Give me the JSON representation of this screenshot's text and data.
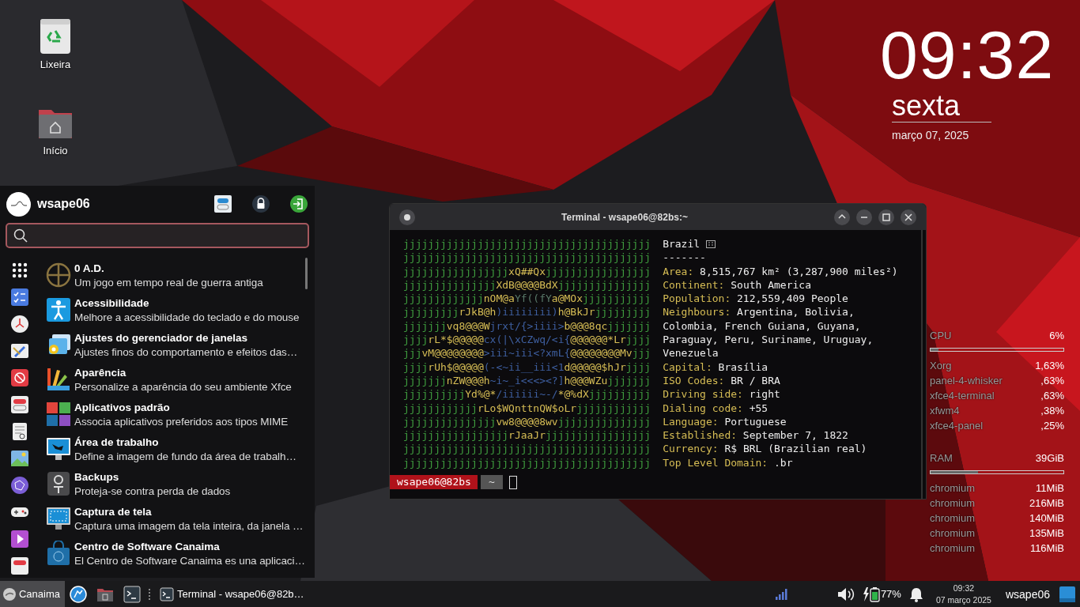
{
  "desktop_icons": [
    {
      "label": "Lixeira"
    },
    {
      "label": "Início"
    }
  ],
  "clock": {
    "time": "09:32",
    "weekday": "sexta",
    "date": "março 07, 2025"
  },
  "menu": {
    "user": "wsape06",
    "apps": [
      {
        "title": "0 A.D.",
        "description": "Um jogo em tempo real de guerra antiga"
      },
      {
        "title": "Acessibilidade",
        "description": "Melhore a acessibilidade do teclado e do mouse"
      },
      {
        "title": "Ajustes do gerenciador de janelas",
        "description": "Ajustes finos do comportamento e efeitos das…"
      },
      {
        "title": "Aparência",
        "description": "Personalize a aparência do seu ambiente Xfce"
      },
      {
        "title": "Aplicativos padrão",
        "description": "Associa aplicativos preferidos aos tipos MIME"
      },
      {
        "title": "Área de trabalho",
        "description": "Define a imagem de fundo da área de trabalh…"
      },
      {
        "title": "Backups",
        "description": "Proteja-se contra perda de dados"
      },
      {
        "title": "Captura de tela",
        "description": "Captura uma imagem da tela inteira, da janela …"
      },
      {
        "title": "Centro de Software Canaima",
        "description": "El Centro de Software Canaima es una aplicaci…"
      }
    ]
  },
  "terminal": {
    "title": "Terminal - wsape06@82bs:~",
    "art": [
      [
        {
          "text": "jjjjjjjjjjjjjjjjjjjjjjjjjjjjjjjjjjjjjjjj",
          "color": "#3f9e3f"
        }
      ],
      [
        {
          "text": "jjjjjjjjjjjjjjjjjjjjjjjjjjjjjjjjjjjjjjjj",
          "color": "#3f9e3f"
        }
      ],
      [
        {
          "text": "jjjjjjjjjjjjjjjjj",
          "color": "#3f9e3f"
        },
        {
          "text": "xQ##Qx",
          "color": "#d6bd55"
        },
        {
          "text": "jjjjjjjjjjjjjjjjj",
          "color": "#3f9e3f"
        }
      ],
      [
        {
          "text": "jjjjjjjjjjjjjjj",
          "color": "#3f9e3f"
        },
        {
          "text": "XdB@@@@BdX",
          "color": "#d6bd55"
        },
        {
          "text": "jjjjjjjjjjjjjjj",
          "color": "#3f9e3f"
        }
      ],
      [
        {
          "text": "jjjjjjjjjjjjj",
          "color": "#3f9e3f"
        },
        {
          "text": "nOM@a",
          "color": "#d6bd55"
        },
        {
          "text": "Yf((fY",
          "color": "#5a7a6a"
        },
        {
          "text": "a@MOx",
          "color": "#d6bd55"
        },
        {
          "text": "jjjjjjjjjjj",
          "color": "#3f9e3f"
        }
      ],
      [
        {
          "text": "jjjjjjjjj",
          "color": "#3f9e3f"
        },
        {
          "text": "rJkB@h",
          "color": "#d6bd55"
        },
        {
          "text": ")iiiiiiii)",
          "color": "#3e5fa0"
        },
        {
          "text": "h@BkJr",
          "color": "#d6bd55"
        },
        {
          "text": "jjjjjjjjj",
          "color": "#3f9e3f"
        }
      ],
      [
        {
          "text": "jjjjjjj",
          "color": "#3f9e3f"
        },
        {
          "text": "vq8@@@W",
          "color": "#d6bd55"
        },
        {
          "text": "jrxt/{>iiii>",
          "color": "#3e5fa0"
        },
        {
          "text": "b@@@8qc",
          "color": "#d6bd55"
        },
        {
          "text": "jjjjjjj",
          "color": "#3f9e3f"
        }
      ],
      [
        {
          "text": "jjjj",
          "color": "#3f9e3f"
        },
        {
          "text": "rL*$@@@@@",
          "color": "#d6bd55"
        },
        {
          "text": "cx(|\\xCZwq/<i{",
          "color": "#3e5fa0"
        },
        {
          "text": "@@@@@@*Lr",
          "color": "#d6bd55"
        },
        {
          "text": "jjjj",
          "color": "#3f9e3f"
        }
      ],
      [
        {
          "text": "jjj",
          "color": "#3f9e3f"
        },
        {
          "text": "vM@@@@@@@@",
          "color": "#d6bd55"
        },
        {
          "text": ">iii~iii<?xmL{",
          "color": "#3e5fa0"
        },
        {
          "text": "@@@@@@@@Mv",
          "color": "#d6bd55"
        },
        {
          "text": "jjj",
          "color": "#3f9e3f"
        }
      ],
      [
        {
          "text": "jjjj",
          "color": "#3f9e3f"
        },
        {
          "text": "rUh$@@@@@",
          "color": "#d6bd55"
        },
        {
          "text": "(-<~ii__iii<1",
          "color": "#3e5fa0"
        },
        {
          "text": "d@@@@@$hJr",
          "color": "#d6bd55"
        },
        {
          "text": "jjjj",
          "color": "#3f9e3f"
        }
      ],
      [
        {
          "text": "jjjjjjj",
          "color": "#3f9e3f"
        },
        {
          "text": "nZW@@@h",
          "color": "#d6bd55"
        },
        {
          "text": "~i~_i<<<><?]",
          "color": "#3e5fa0"
        },
        {
          "text": "h@@@WZu",
          "color": "#d6bd55"
        },
        {
          "text": "jjjjjjj",
          "color": "#3f9e3f"
        }
      ],
      [
        {
          "text": "jjjjjjjjjj",
          "color": "#3f9e3f"
        },
        {
          "text": "Yd%@*",
          "color": "#d6bd55"
        },
        {
          "text": "/iiiiii~-/",
          "color": "#3e5fa0"
        },
        {
          "text": "*@%dX",
          "color": "#d6bd55"
        },
        {
          "text": "jjjjjjjjjj",
          "color": "#3f9e3f"
        }
      ],
      [
        {
          "text": "jjjjjjjjjjjj",
          "color": "#3f9e3f"
        },
        {
          "text": "rLo$WQnttnQW$oLr",
          "color": "#d6bd55"
        },
        {
          "text": "jjjjjjjjjjjj",
          "color": "#3f9e3f"
        }
      ],
      [
        {
          "text": "jjjjjjjjjjjjjjj",
          "color": "#3f9e3f"
        },
        {
          "text": "vw8@@@@8wv",
          "color": "#d6bd55"
        },
        {
          "text": "jjjjjjjjjjjjjjj",
          "color": "#3f9e3f"
        }
      ],
      [
        {
          "text": "jjjjjjjjjjjjjjjjj",
          "color": "#3f9e3f"
        },
        {
          "text": "rJaaJr",
          "color": "#d6bd55"
        },
        {
          "text": "jjjjjjjjjjjjjjjjj",
          "color": "#3f9e3f"
        }
      ],
      [
        {
          "text": "jjjjjjjjjjjjjjjjjjjjjjjjjjjjjjjjjjjjjjjj",
          "color": "#3f9e3f"
        }
      ],
      [
        {
          "text": "jjjjjjjjjjjjjjjjjjjjjjjjjjjjjjjjjjjjjjjj",
          "color": "#3f9e3f"
        }
      ]
    ],
    "info": {
      "heading": "Brazil",
      "rule": "-------",
      "fields": [
        {
          "label": "Area:",
          "value": "8,515,767 km² (3,287,900 miles²)"
        },
        {
          "label": "Continent:",
          "value": "South America"
        },
        {
          "label": "Population:",
          "value": "212,559,409 People"
        },
        {
          "label": "Neighbours:",
          "value": "Argentina, Bolivia, Colombia, French Guiana, Guyana, Paraguay, Peru, Suriname, Uruguay, Venezuela"
        },
        {
          "label": "Capital:",
          "value": "Brasília"
        },
        {
          "label": "ISO Codes:",
          "value": "BR / BRA"
        },
        {
          "label": "Driving side:",
          "value": "right"
        },
        {
          "label": "Dialing code:",
          "value": "+55"
        },
        {
          "label": "Language:",
          "value": "Portuguese"
        },
        {
          "label": "Established:",
          "value": "September 7, 1822"
        },
        {
          "label": "Currency:",
          "value": "R$ BRL (Brazilian real)"
        },
        {
          "label": "Top Level Domain:",
          "value": ".br"
        }
      ]
    },
    "prompt": {
      "user_host": "wsape06@82bs",
      "directory": "~"
    }
  },
  "conky": [
    {
      "label": "CPU",
      "value": "6%",
      "level": 0.06,
      "processes": [
        {
          "name": "Xorg",
          "value": "1,63%"
        },
        {
          "name": "panel-4-whisker",
          "value": ",63%"
        },
        {
          "name": "xfce4-terminal",
          "value": ",63%"
        },
        {
          "name": "xfwm4",
          "value": ",38%"
        },
        {
          "name": "xfce4-panel",
          "value": ",25%"
        }
      ]
    },
    {
      "label": "RAM",
      "value": "39GiB",
      "level": 0.36,
      "processes": [
        {
          "name": "chromium",
          "value": "11MiB"
        },
        {
          "name": "chromium",
          "value": "216MiB"
        },
        {
          "name": "chromium",
          "value": "140MiB"
        },
        {
          "name": "chromium",
          "value": "135MiB"
        },
        {
          "name": "chromium",
          "value": "116MiB"
        }
      ]
    }
  ],
  "taskbar": {
    "start": "Canaima",
    "task": "Terminal - wsape06@82b…",
    "battery": "77%",
    "time": "09:32",
    "date": "07 março 2025",
    "user": "wsape06"
  }
}
